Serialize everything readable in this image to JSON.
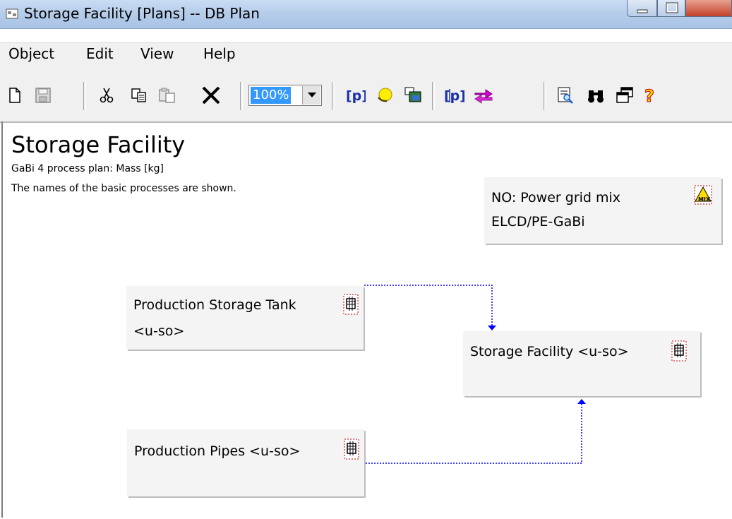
{
  "window": {
    "title": "Storage Facility [Plans] -- DB Plan"
  },
  "menu": {
    "items": [
      "Object",
      "Edit",
      "View",
      "Help"
    ]
  },
  "toolbar": {
    "zoom_value": "100%",
    "icons": [
      "new-icon",
      "save-icon",
      "cut-icon",
      "copy-icon",
      "paste-icon",
      "delete-icon",
      "zoom-select",
      "process-p-icon",
      "light-bulb-icon",
      "window-list-icon",
      "parameter-p-icon",
      "swap-arrows-icon",
      "preview-icon",
      "find-binoculars-icon",
      "cascade-windows-icon",
      "help-icon"
    ]
  },
  "plan": {
    "title": "Storage Facility",
    "subtitle": "GaBi 4 process plan: Mass [kg]",
    "note": "The names of the basic processes are shown."
  },
  "processes": {
    "power_grid": {
      "line1": "NO: Power grid mix",
      "line2": "ELCD/PE-GaBi"
    },
    "storage_tank": {
      "line1": "Production Storage Tank",
      "line2": "<u-so>"
    },
    "storage_facility": {
      "line1": "Storage Facility <u-so>"
    },
    "pipes": {
      "line1": "Production Pipes <u-so>"
    }
  },
  "colors": {
    "flow": "#0000ff",
    "box": "#f4f4f4",
    "accent_red": "#cc0000"
  }
}
